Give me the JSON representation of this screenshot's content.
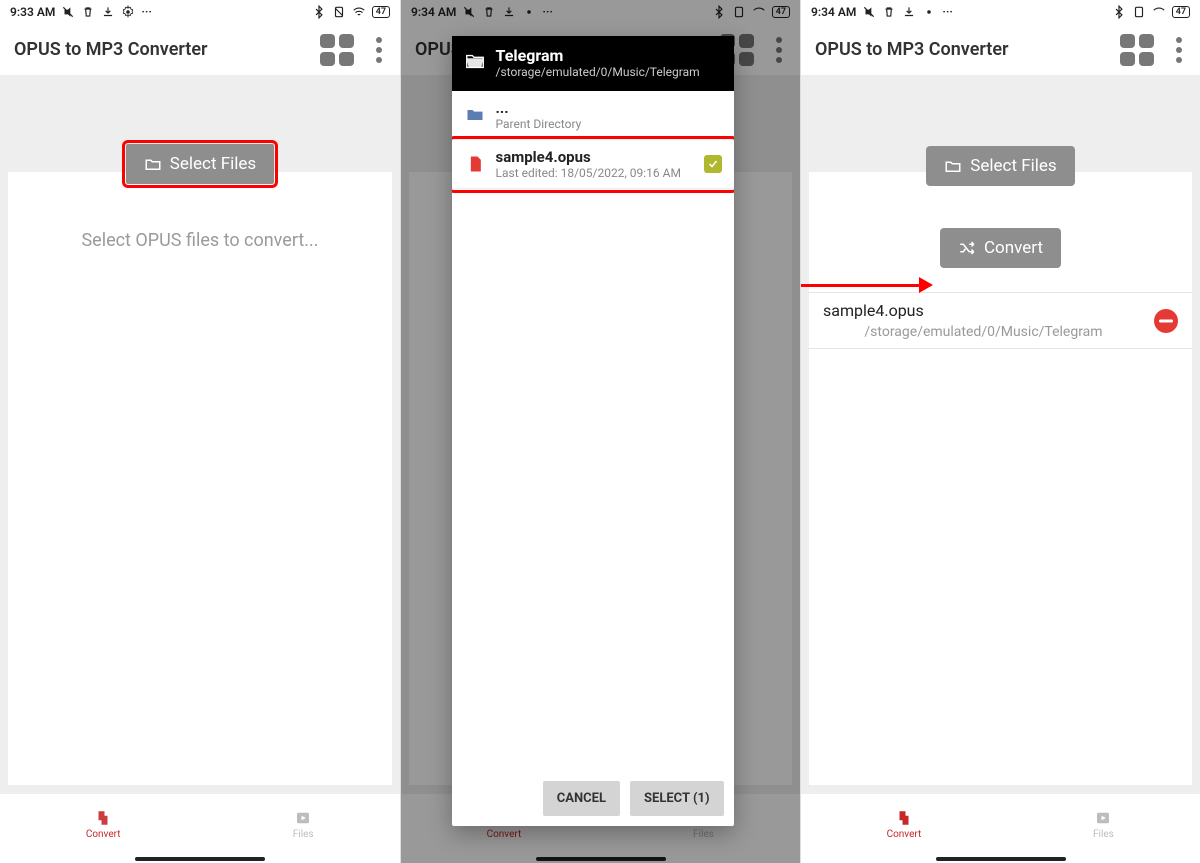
{
  "screens": {
    "s1": {
      "time": "9:33 AM"
    },
    "s2": {
      "time": "9:34 AM"
    },
    "s3": {
      "time": "9:34 AM"
    }
  },
  "status_battery": "47",
  "app_title": "OPUS to MP3 Converter",
  "buttons": {
    "select_files": "Select Files",
    "convert": "Convert",
    "cancel": "CANCEL",
    "select_count": "SELECT (1)"
  },
  "hints": {
    "empty": "Select OPUS files to convert..."
  },
  "nav": {
    "convert": "Convert",
    "files": "Files"
  },
  "picker": {
    "folder_title": "Telegram",
    "folder_path": "/storage/emulated/0/Music/Telegram",
    "parent_dots": "...",
    "parent_label": "Parent Directory",
    "file_name": "sample4.opus",
    "file_sub": "Last edited: 18/05/2022, 09:16 AM"
  },
  "selected_file": {
    "name": "sample4.opus",
    "path": "/storage/emulated/0/Music/Telegram"
  }
}
